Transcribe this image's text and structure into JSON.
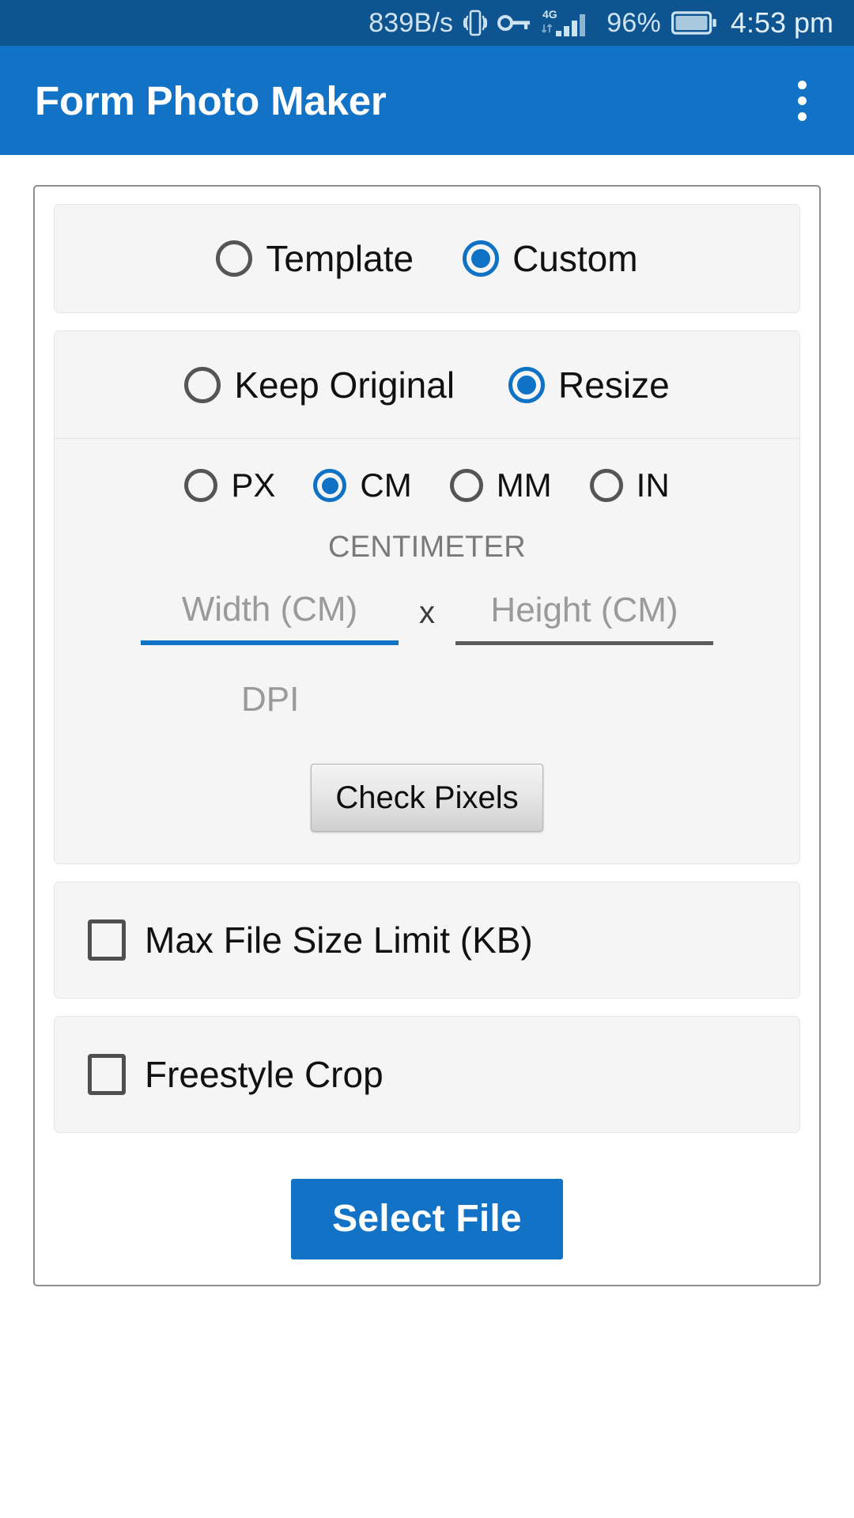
{
  "status_bar": {
    "network_speed": "839B/s",
    "vibrate_icon": "vibrate-icon",
    "key_icon": "key-icon",
    "network_type": "4G",
    "signal_icon": "signal-bars-icon",
    "battery_percent": "96%",
    "battery_icon": "battery-icon",
    "time": "4:53 pm",
    "background_color": "#0d5490"
  },
  "app_bar": {
    "title": "Form Photo Maker",
    "overflow_icon": "overflow-menu-icon",
    "background_color": "#1273c6"
  },
  "type_section": {
    "options": [
      {
        "label": "Template",
        "selected": false
      },
      {
        "label": "Custom",
        "selected": true
      }
    ]
  },
  "resize_section": {
    "mode_options": [
      {
        "label": "Keep Original",
        "selected": false
      },
      {
        "label": "Resize",
        "selected": true
      }
    ],
    "unit_options": [
      {
        "label": "PX",
        "selected": false
      },
      {
        "label": "CM",
        "selected": true
      },
      {
        "label": "MM",
        "selected": false
      },
      {
        "label": "IN",
        "selected": false
      }
    ],
    "unit_name": "CENTIMETER",
    "width_placeholder": "Width (CM)",
    "width_value": "",
    "separator": "x",
    "height_placeholder": "Height (CM)",
    "height_value": "",
    "dpi_placeholder": "DPI",
    "dpi_value": "",
    "check_pixels_label": "Check Pixels",
    "accent_color": "#0f72c4"
  },
  "max_file_size": {
    "label": "Max File Size Limit (KB)",
    "checked": false
  },
  "freestyle_crop": {
    "label": "Freestyle Crop",
    "checked": false
  },
  "select_file": {
    "label": "Select File",
    "color": "#1273c6"
  }
}
